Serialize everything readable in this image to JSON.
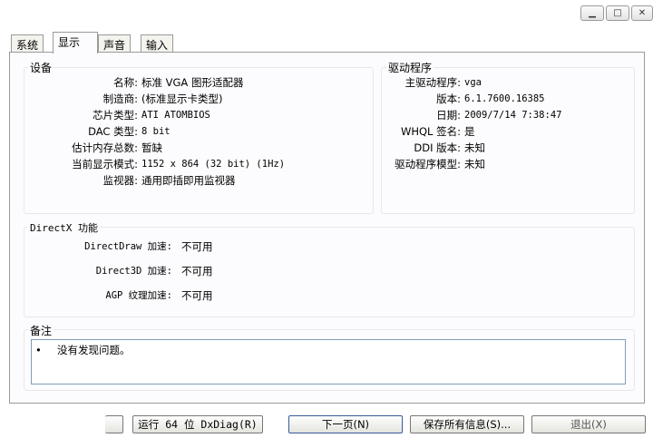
{
  "tabs": [
    "系统",
    "显示",
    "声音",
    "输入"
  ],
  "device": {
    "title": "设备",
    "rows": [
      {
        "label": "名称:",
        "value": "标准 VGA 图形适配器"
      },
      {
        "label": "制造商:",
        "value": "(标准显示卡类型)"
      },
      {
        "label": "芯片类型:",
        "value": "ATI ATOMBIOS"
      },
      {
        "label": "DAC 类型:",
        "value": "8 bit"
      },
      {
        "label": "估计内存总数:",
        "value": "暂缺"
      },
      {
        "label": "当前显示模式:",
        "value": "1152 x 864 (32 bit) (1Hz)"
      },
      {
        "label": "监视器:",
        "value": "通用即插即用监视器"
      }
    ]
  },
  "driver": {
    "title": "驱动程序",
    "rows": [
      {
        "label": "主驱动程序:",
        "value": "vga"
      },
      {
        "label": "版本:",
        "value": "6.1.7600.16385"
      },
      {
        "label": "日期:",
        "value": "2009/7/14 7:38:47"
      },
      {
        "label": "WHQL 签名:",
        "value": "是"
      },
      {
        "label": "DDI 版本:",
        "value": "未知"
      },
      {
        "label": "驱动程序模型:",
        "value": "未知"
      }
    ]
  },
  "directx": {
    "title": "DirectX 功能",
    "rows": [
      {
        "label": "DirectDraw 加速:",
        "value": "不可用"
      },
      {
        "label": "Direct3D 加速:",
        "value": "不可用"
      },
      {
        "label": "AGP 纹理加速:",
        "value": "不可用"
      }
    ]
  },
  "notes": {
    "title": "备注",
    "bullet": "•",
    "text": "没有发现问题。"
  },
  "buttons": {
    "run64": "运行 64 位 DxDiag(R)",
    "next": "下一页(N)",
    "save": "保存所有信息(S)...",
    "exit": "退出(X)"
  },
  "window": {
    "minimize_glyph": "▁",
    "maximize_glyph": "□",
    "close_glyph": "✕"
  }
}
